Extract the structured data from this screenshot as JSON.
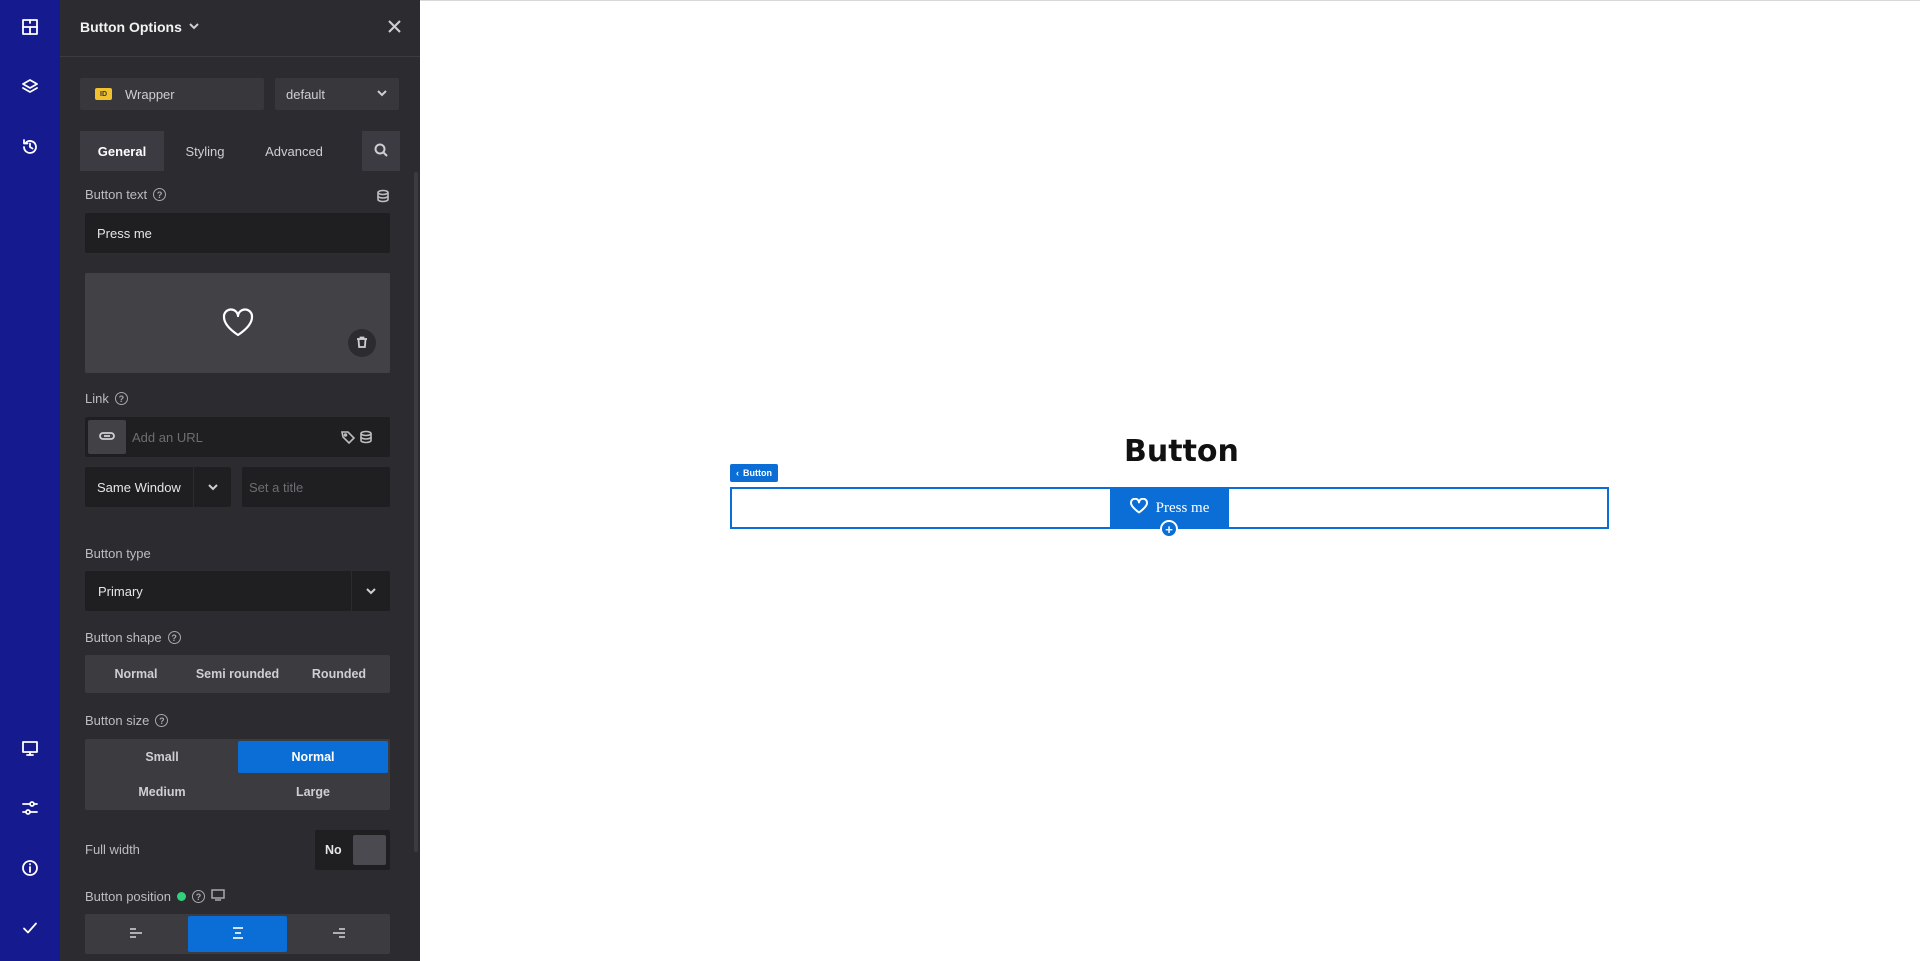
{
  "panel": {
    "title": "Button Options",
    "selector_label": "Wrapper",
    "selector_badge": "ID",
    "state_select": "default"
  },
  "tabs": [
    "General",
    "Styling",
    "Advanced"
  ],
  "fields": {
    "button_text_label": "Button text",
    "button_text_value": "Press me",
    "link_label": "Link",
    "link_placeholder": "Add an URL",
    "window_select": "Same Window",
    "title_placeholder": "Set a title",
    "button_type_label": "Button type",
    "button_type_value": "Primary",
    "button_shape_label": "Button shape",
    "button_shape_options": [
      "Normal",
      "Semi rounded",
      "Rounded"
    ],
    "button_size_label": "Button size",
    "button_size_options": [
      "Small",
      "Normal",
      "Medium",
      "Large"
    ],
    "button_size_selected": "Normal",
    "full_width_label": "Full width",
    "full_width_value": "No",
    "button_position_label": "Button position",
    "button_position_selected": "center"
  },
  "canvas": {
    "heading": "Button",
    "element_tag": "Button",
    "button_label": "Press me",
    "add_symbol": "+"
  },
  "colors": {
    "rail": "#151a8f",
    "panel": "#2c2c30",
    "accent": "#0a6ed6",
    "status_green": "#2fd17d"
  },
  "icons": {
    "rail_top": [
      "layout-icon",
      "layers-icon",
      "history-icon"
    ],
    "rail_bottom": [
      "desktop-icon",
      "sliders-icon",
      "info-icon",
      "check-icon"
    ],
    "button_icon": "heart-icon"
  }
}
